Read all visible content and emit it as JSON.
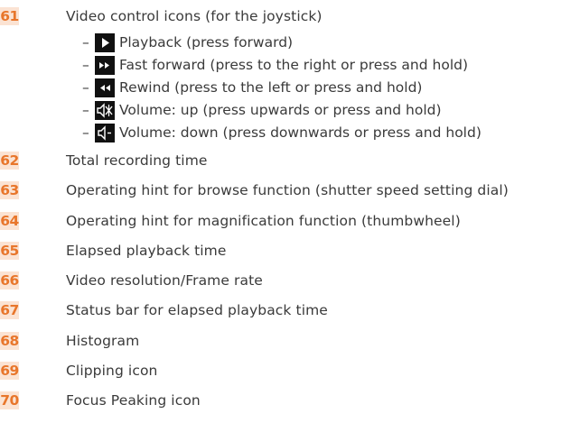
{
  "items": [
    {
      "number": "61",
      "label": "Video control icons (for the joystick)"
    },
    {
      "number": "62",
      "label": "Total recording time"
    },
    {
      "number": "63",
      "label": "Operating hint for browse function (shutter speed setting dial)"
    },
    {
      "number": "64",
      "label": "Operating hint for magnification function (thumbwheel)"
    },
    {
      "number": "65",
      "label": "Elapsed playback time"
    },
    {
      "number": "66",
      "label": "Video resolution/Frame rate"
    },
    {
      "number": "67",
      "label": "Status bar for elapsed playback time"
    },
    {
      "number": "68",
      "label": "Histogram"
    },
    {
      "number": "69",
      "label": "Clipping icon"
    },
    {
      "number": "70",
      "label": "Focus Peaking icon"
    }
  ],
  "video_controls": [
    {
      "dash": "–",
      "icon": "play-icon",
      "label": "Playback (press forward)"
    },
    {
      "dash": "–",
      "icon": "fast-forward-icon",
      "label": "Fast forward (press to the right or press and hold)"
    },
    {
      "dash": "–",
      "icon": "rewind-icon",
      "label": "Rewind (press to the left or press and hold)"
    },
    {
      "dash": "–",
      "icon": "volume-up-icon",
      "label": "Volume: up (press upwards or press and hold)"
    },
    {
      "dash": "–",
      "icon": "volume-down-icon",
      "label": "Volume: down (press downwards or press and hold)"
    }
  ],
  "colors": {
    "number_text": "#e8762b",
    "number_background": "#fbe3d3",
    "body_text": "#3a3a3a",
    "icon_background": "#111111"
  }
}
